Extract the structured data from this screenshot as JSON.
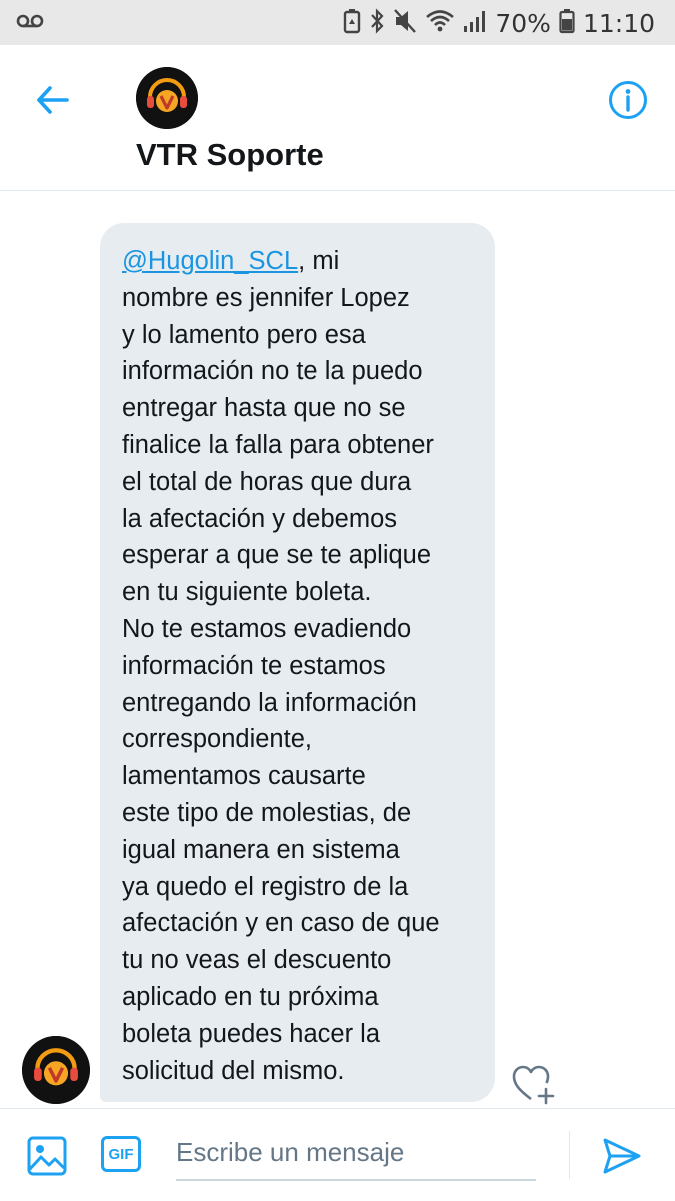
{
  "status_bar": {
    "battery": "70%",
    "time": "11:10"
  },
  "header": {
    "title": "VTR Soporte"
  },
  "message": {
    "mention": "@Hugolin_SCL",
    "text": ", mi\nnombre es jennifer Lopez\ny lo lamento pero esa\ninformación no te la puedo\nentregar hasta que no se\nfinalice la falla para obtener\nel total de horas que dura\nla afectación y debemos\nesperar a que se te aplique\nen tu siguiente boleta.\nNo te estamos evadiendo\ninformación te estamos\nentregando la información\ncorrespondiente,\nlamentamos causarte\neste tipo de molestias, de\nigual manera en sistema\nya quedo el registro de la\nafectación y en caso de que\ntu no veas el descuento\naplicado en tu próxima\nboleta puedes hacer la\nsolicitud del mismo."
  },
  "composer": {
    "placeholder": "Escribe un mensaje",
    "gif_label": "GIF"
  },
  "colors": {
    "accent": "#1da1f2",
    "bubble": "#e6ecf0"
  }
}
